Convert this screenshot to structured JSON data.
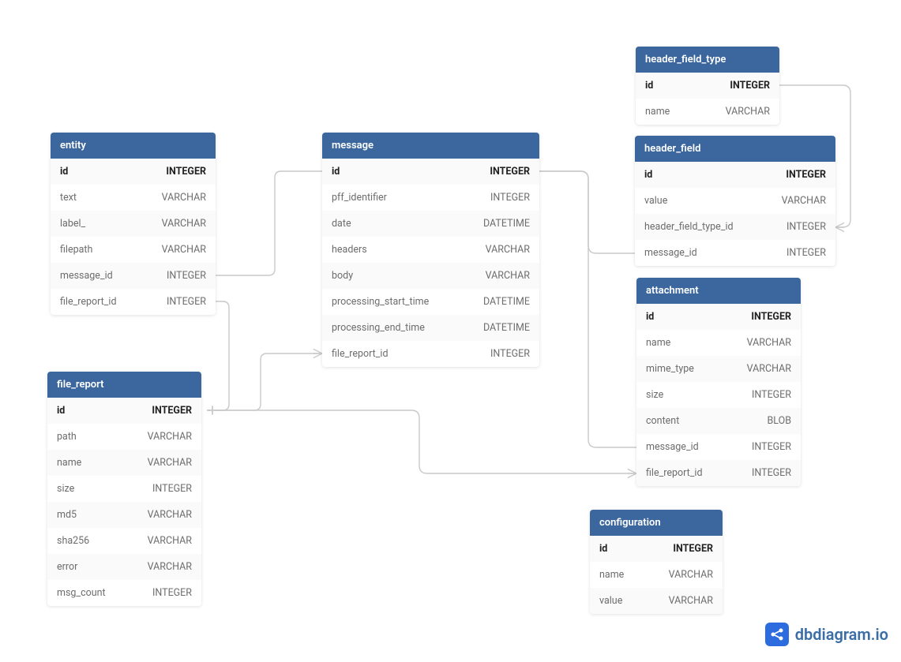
{
  "tables": {
    "header_field_type": {
      "name": "header_field_type",
      "rows": [
        {
          "name": "id",
          "type": "INTEGER",
          "pk": true
        },
        {
          "name": "name",
          "type": "VARCHAR"
        }
      ]
    },
    "entity": {
      "name": "entity",
      "rows": [
        {
          "name": "id",
          "type": "INTEGER",
          "pk": true
        },
        {
          "name": "text",
          "type": "VARCHAR"
        },
        {
          "name": "label_",
          "type": "VARCHAR"
        },
        {
          "name": "filepath",
          "type": "VARCHAR"
        },
        {
          "name": "message_id",
          "type": "INTEGER"
        },
        {
          "name": "file_report_id",
          "type": "INTEGER"
        }
      ]
    },
    "message": {
      "name": "message",
      "rows": [
        {
          "name": "id",
          "type": "INTEGER",
          "pk": true
        },
        {
          "name": "pff_identifier",
          "type": "INTEGER"
        },
        {
          "name": "date",
          "type": "DATETIME"
        },
        {
          "name": "headers",
          "type": "VARCHAR"
        },
        {
          "name": "body",
          "type": "VARCHAR"
        },
        {
          "name": "processing_start_time",
          "type": "DATETIME"
        },
        {
          "name": "processing_end_time",
          "type": "DATETIME"
        },
        {
          "name": "file_report_id",
          "type": "INTEGER"
        }
      ]
    },
    "header_field": {
      "name": "header_field",
      "rows": [
        {
          "name": "id",
          "type": "INTEGER",
          "pk": true
        },
        {
          "name": "value",
          "type": "VARCHAR"
        },
        {
          "name": "header_field_type_id",
          "type": "INTEGER"
        },
        {
          "name": "message_id",
          "type": "INTEGER"
        }
      ]
    },
    "attachment": {
      "name": "attachment",
      "rows": [
        {
          "name": "id",
          "type": "INTEGER",
          "pk": true
        },
        {
          "name": "name",
          "type": "VARCHAR"
        },
        {
          "name": "mime_type",
          "type": "VARCHAR"
        },
        {
          "name": "size",
          "type": "INTEGER"
        },
        {
          "name": "content",
          "type": "BLOB"
        },
        {
          "name": "message_id",
          "type": "INTEGER"
        },
        {
          "name": "file_report_id",
          "type": "INTEGER"
        }
      ]
    },
    "file_report": {
      "name": "file_report",
      "rows": [
        {
          "name": "id",
          "type": "INTEGER",
          "pk": true
        },
        {
          "name": "path",
          "type": "VARCHAR"
        },
        {
          "name": "name",
          "type": "VARCHAR"
        },
        {
          "name": "size",
          "type": "INTEGER"
        },
        {
          "name": "md5",
          "type": "VARCHAR"
        },
        {
          "name": "sha256",
          "type": "VARCHAR"
        },
        {
          "name": "error",
          "type": "VARCHAR"
        },
        {
          "name": "msg_count",
          "type": "INTEGER"
        }
      ]
    },
    "configuration": {
      "name": "configuration",
      "rows": [
        {
          "name": "id",
          "type": "INTEGER",
          "pk": true
        },
        {
          "name": "name",
          "type": "VARCHAR"
        },
        {
          "name": "value",
          "type": "VARCHAR"
        }
      ]
    }
  },
  "brand": "dbdiagram.io"
}
